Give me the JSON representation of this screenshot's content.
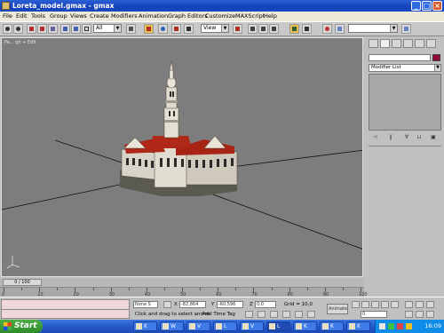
{
  "window": {
    "title": "Loreta_model.gmax - gmax"
  },
  "menu": [
    "File",
    "Edit",
    "Tools",
    "Group",
    "Views",
    "Create",
    "Modifiers",
    "Animation",
    "Graph Editors",
    "Customize",
    "MAXScript",
    "Help"
  ],
  "toolbar": {
    "selection_filter": "All",
    "ref_coord": "View",
    "named_sel": ""
  },
  "viewport": {
    "label": "Pe... gh + Edit"
  },
  "cmd_panel": {
    "modifier_list": "Modifier List"
  },
  "time_slider": {
    "frame": "0 / 100"
  },
  "trackbar": {
    "ticks": [
      "0",
      "10",
      "20",
      "30",
      "40",
      "50",
      "60",
      "70",
      "80",
      "90",
      "100"
    ]
  },
  "status": {
    "selection": "None S",
    "x_label": "X",
    "x_value": "-82,864",
    "y_label": "Y",
    "y_value": "-60,596",
    "z_label": "Z",
    "z_value": "0,0",
    "grid": "Grid = 10,0",
    "prompt": "Click and drag to select and m",
    "add_time_tag": "Add Time Tag",
    "animate": "Animate",
    "frame": "0"
  },
  "taskbar": {
    "start": "Start",
    "tasks": [
      "K",
      "W",
      "V",
      "L",
      "V",
      "L",
      "K",
      "K",
      "K"
    ],
    "clock": "16:09"
  },
  "colors": {
    "object_color": "#900a3c",
    "viewport_bg": "#7d7d7d",
    "roof": "#b02818"
  }
}
